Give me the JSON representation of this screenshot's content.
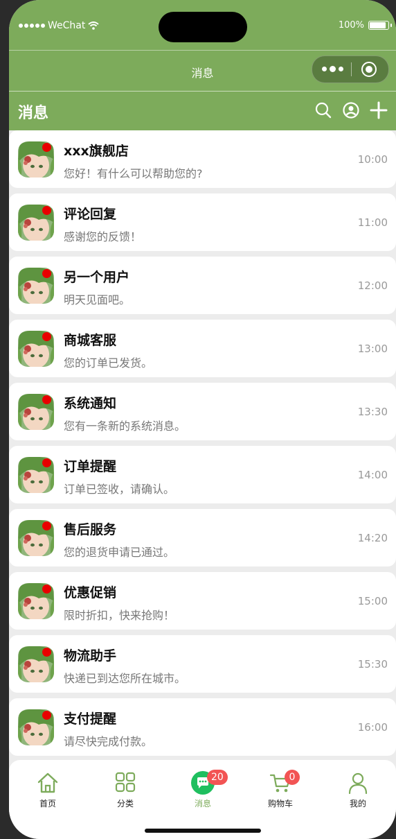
{
  "status": {
    "carrier": "WeChat",
    "battery": "100%"
  },
  "nav": {
    "title": "消息"
  },
  "page": {
    "title": "消息"
  },
  "colors": {
    "brand": "#7dab5b",
    "unread": "#e80000",
    "badge": "#f25454"
  },
  "header_icons": [
    "search-icon",
    "user-circle-icon",
    "plus-icon"
  ],
  "messages": [
    {
      "name": "xxx旗舰店",
      "text": "您好！有什么可以帮助您的?",
      "time": "10:00",
      "unread": true
    },
    {
      "name": "评论回复",
      "text": "感谢您的反馈！",
      "time": "11:00",
      "unread": true
    },
    {
      "name": "另一个用户",
      "text": "明天见面吧。",
      "time": "12:00",
      "unread": true
    },
    {
      "name": "商城客服",
      "text": "您的订单已发货。",
      "time": "13:00",
      "unread": true
    },
    {
      "name": "系统通知",
      "text": "您有一条新的系统消息。",
      "time": "13:30",
      "unread": true
    },
    {
      "name": "订单提醒",
      "text": "订单已签收，请确认。",
      "time": "14:00",
      "unread": true
    },
    {
      "name": "售后服务",
      "text": "您的退货申请已通过。",
      "time": "14:20",
      "unread": true
    },
    {
      "name": "优惠促销",
      "text": "限时折扣，快来抢购！",
      "time": "15:00",
      "unread": true
    },
    {
      "name": "物流助手",
      "text": "快递已到达您所在城市。",
      "time": "15:30",
      "unread": true
    },
    {
      "name": "支付提醒",
      "text": "请尽快完成付款。",
      "time": "16:00",
      "unread": true
    }
  ],
  "tabs": [
    {
      "label": "首页",
      "icon": "home-icon"
    },
    {
      "label": "分类",
      "icon": "grid-icon"
    },
    {
      "label": "消息",
      "icon": "chat-icon",
      "badge": "20",
      "active": true
    },
    {
      "label": "购物车",
      "icon": "cart-icon",
      "badge": "0"
    },
    {
      "label": "我的",
      "icon": "person-icon"
    }
  ]
}
